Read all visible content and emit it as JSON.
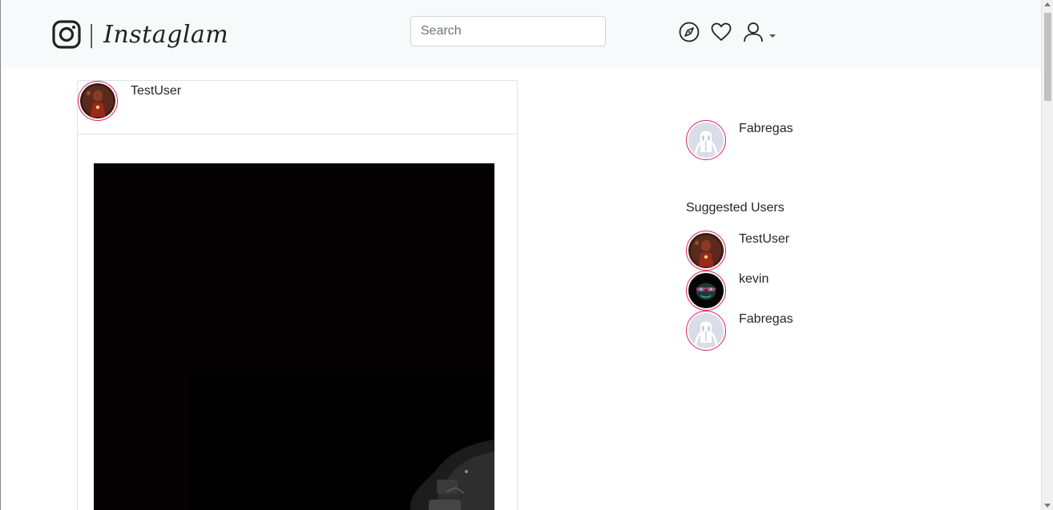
{
  "navbar": {
    "brand_separator": "|",
    "brand_name": "Instaglam",
    "search_placeholder": "Search",
    "icons": [
      "instagram-icon",
      "compass-icon",
      "heart-icon",
      "user-icon",
      "caret-down-icon"
    ]
  },
  "post": {
    "username": "TestUser"
  },
  "sidebar": {
    "current_user": {
      "name": "Fabregas"
    },
    "suggested_title": "Suggested Users",
    "suggested": [
      {
        "name": "TestUser"
      },
      {
        "name": "kevin"
      },
      {
        "name": "Fabregas"
      }
    ]
  },
  "colors": {
    "navbar_bg": "#f8f9fa",
    "avatar_ring": "#e0245e",
    "text": "#212529"
  }
}
